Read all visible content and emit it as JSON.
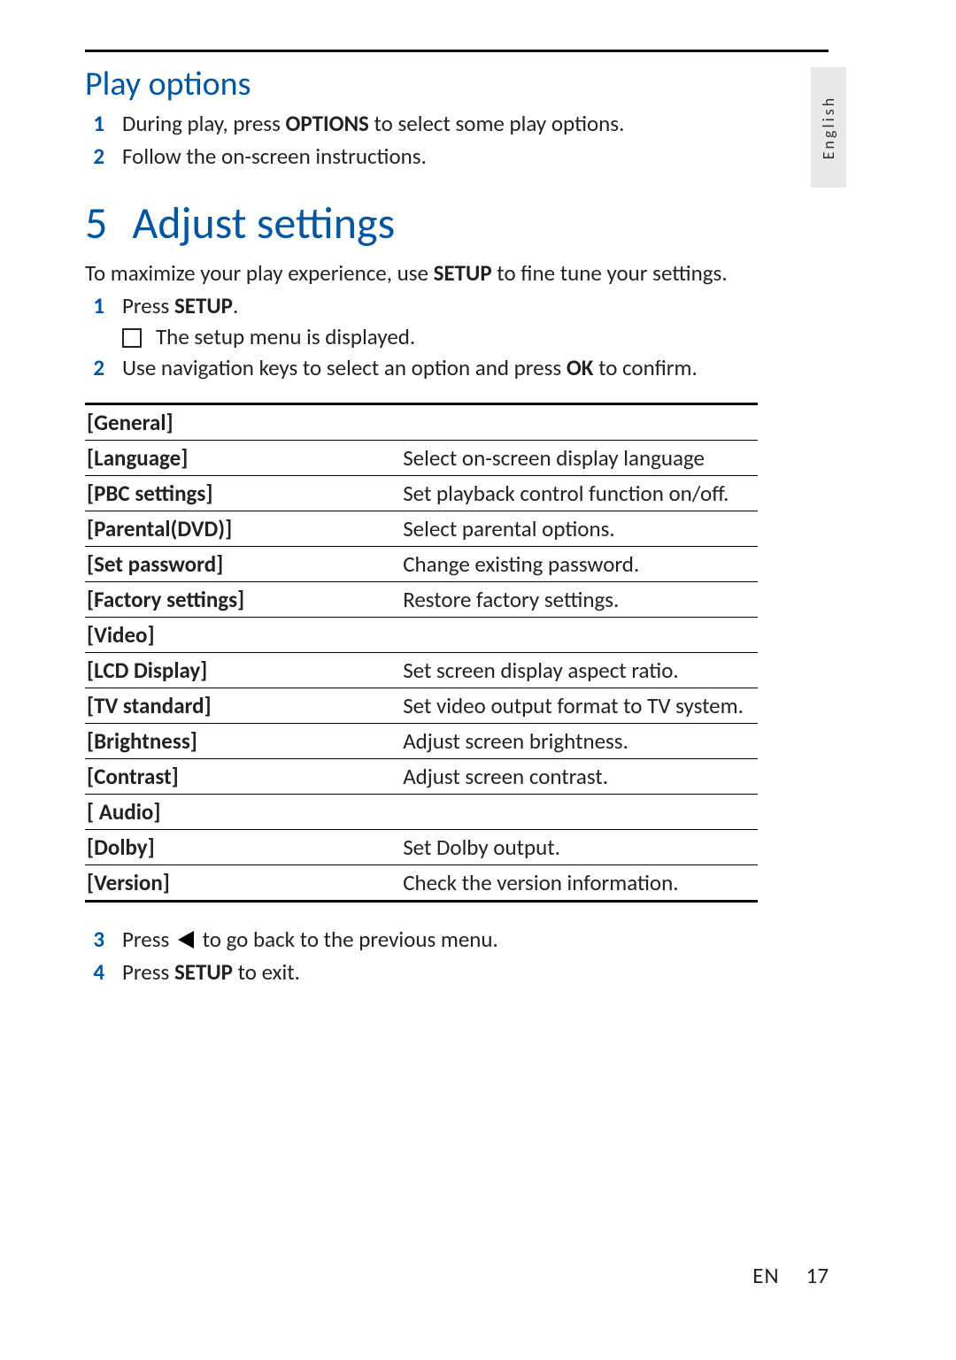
{
  "language_tab": "English",
  "section_play": {
    "heading": "Play options",
    "steps": [
      {
        "pre": "During play, press ",
        "bold": "OPTIONS",
        "post": " to select some play options."
      },
      {
        "pre": "Follow the on-screen instructions.",
        "bold": "",
        "post": ""
      }
    ]
  },
  "chapter": {
    "number": "5",
    "title": "Adjust settings",
    "intro_pre": "To maximize your play experience, use ",
    "intro_bold": "SETUP",
    "intro_post": " to fine tune your settings.",
    "steps12": [
      {
        "pre": "Press ",
        "bold": "SETUP",
        "post": ".",
        "sub": "The setup menu is displayed."
      },
      {
        "pre": "Use navigation keys to select an option and press ",
        "bold": "OK",
        "post": " to confirm."
      }
    ],
    "step3_pre": "Press ",
    "step3_post": " to go back to the previous menu.",
    "step4_pre": "Press ",
    "step4_bold": "SETUP",
    "step4_post": " to exit."
  },
  "settings_table": [
    {
      "key": "[General]",
      "desc": ""
    },
    {
      "key": "[Language]",
      "desc": "Select on-screen display language"
    },
    {
      "key": "[PBC settings]",
      "desc": "Set playback control function on/off."
    },
    {
      "key": "[Parental(DVD)]",
      "desc": "Select parental options."
    },
    {
      "key": "[Set password]",
      "desc": "Change existing password."
    },
    {
      "key": "[Factory settings]",
      "desc": "Restore factory settings."
    },
    {
      "key": "[Video]",
      "desc": ""
    },
    {
      "key": "[LCD Display]",
      "desc": "Set screen display aspect ratio."
    },
    {
      "key": "[TV standard]",
      "desc": "Set video output format to TV system."
    },
    {
      "key": "[Brightness]",
      "desc": "Adjust screen brightness."
    },
    {
      "key": "[Contrast]",
      "desc": "Adjust screen contrast."
    },
    {
      "key": "[ Audio]",
      "desc": ""
    },
    {
      "key": "[Dolby]",
      "desc": "Set Dolby output."
    },
    {
      "key": "[Version]",
      "desc": "Check the version information."
    }
  ],
  "footer": {
    "lang": "EN",
    "page": "17"
  }
}
